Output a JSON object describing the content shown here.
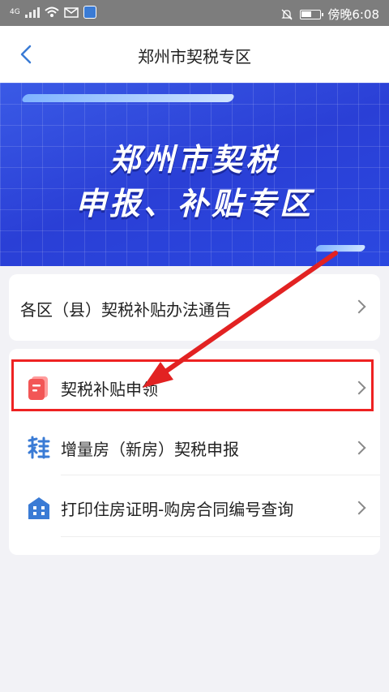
{
  "status_bar": {
    "network": "4G",
    "time": "傍晚6:08"
  },
  "nav": {
    "title": "郑州市契税专区"
  },
  "banner": {
    "line1": "郑州市契税",
    "line2": "申报、补贴专区"
  },
  "notice": {
    "label": "各区（县）契税补贴办法通告"
  },
  "menu": [
    {
      "label": "契税补贴申领",
      "icon": "document-icon"
    },
    {
      "label": "增量房（新房）契税申报",
      "icon": "tax-icon"
    },
    {
      "label": "打印住房证明-购房合同编号查询",
      "icon": "building-icon"
    }
  ],
  "colors": {
    "accent": "#3a7bd5",
    "banner": "#2a3fd6",
    "highlight": "#e22222"
  }
}
